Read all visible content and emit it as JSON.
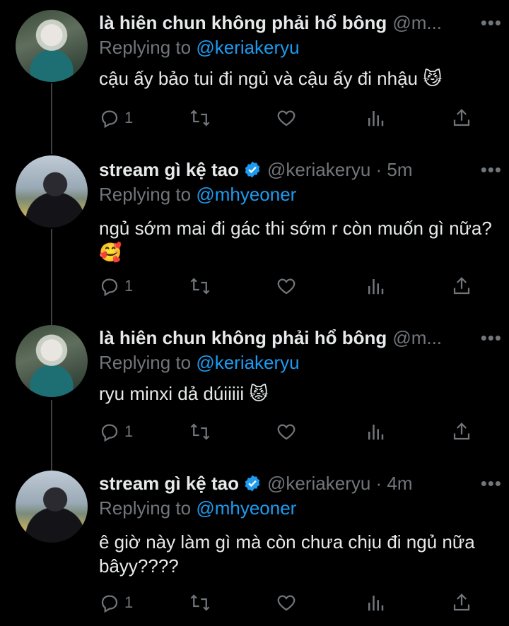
{
  "tweets": [
    {
      "name": "là hiên chun không phải hổ bông",
      "handle": "@m...",
      "verified": false,
      "time": "",
      "replying_label": "Replying to",
      "replying_to": "@keriakeryu",
      "text": "cậu ấy bảo tui đi ngủ và cậu ấy đi nhậu 😼",
      "reply_count": "1",
      "avatar": "avatar-user-hien"
    },
    {
      "name": "stream gì kệ tao",
      "handle": "@keriakeryu · 5m",
      "verified": true,
      "replying_label": "Replying to",
      "replying_to": "@mhyeoner",
      "text": "ngủ sớm mai đi gác thi sớm r còn muốn gì nữa? 🥰",
      "reply_count": "1",
      "avatar": "avatar-user-keria"
    },
    {
      "name": "là hiên chun không phải hổ bông",
      "handle": "@m...",
      "verified": false,
      "replying_label": "Replying to",
      "replying_to": "@keriakeryu",
      "text": "ryu minxi dả dúiiiii 😾",
      "reply_count": "1",
      "avatar": "avatar-user-hien"
    },
    {
      "name": "stream gì kệ tao",
      "handle": "@keriakeryu · 4m",
      "verified": true,
      "replying_label": "Replying to",
      "replying_to": "@mhyeoner",
      "text": "ê giờ này làm gì mà còn chưa chịu đi ngủ nữa bâyy????",
      "reply_count": "1",
      "avatar": "avatar-user-keria"
    }
  ],
  "more_icon": "•••",
  "colors": {
    "background": "#000000",
    "text": "#e7e9ea",
    "secondary": "#71767b",
    "accent": "#1d9bf0"
  },
  "icons": [
    "reply-icon",
    "retweet-icon",
    "like-icon",
    "analytics-icon",
    "share-icon",
    "verified-badge-icon",
    "more-icon"
  ]
}
